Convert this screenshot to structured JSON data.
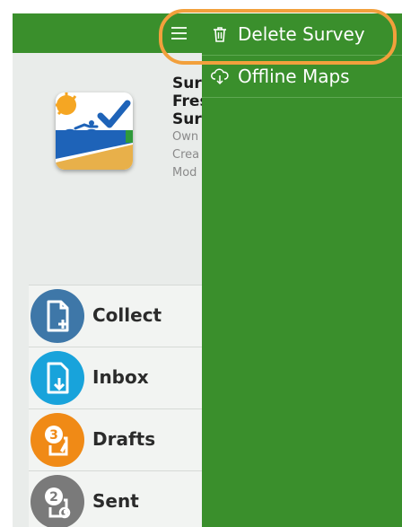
{
  "survey": {
    "title_lines": [
      "Sur",
      "Fres",
      "Sur"
    ],
    "meta_lines": [
      "Own",
      "Crea",
      "Mod"
    ]
  },
  "actions": [
    {
      "label": "Collect",
      "color": "#3e77a8",
      "icon": "collect-icon"
    },
    {
      "label": "Inbox",
      "color": "#18a3db",
      "icon": "inbox-icon"
    },
    {
      "label": "Drafts",
      "color": "#f08a16",
      "icon": "drafts-icon",
      "badge": "3"
    },
    {
      "label": "Sent",
      "color": "#7a7a7a",
      "icon": "sent-icon",
      "badge": "2"
    }
  ],
  "menu": {
    "items": [
      {
        "label": "Delete Survey",
        "icon": "trash-icon"
      },
      {
        "label": "Offline Maps",
        "icon": "cloud-download-icon"
      }
    ]
  },
  "colors": {
    "toolbar_green": "#3a8f2c",
    "highlight_orange": "#f2a03c"
  }
}
